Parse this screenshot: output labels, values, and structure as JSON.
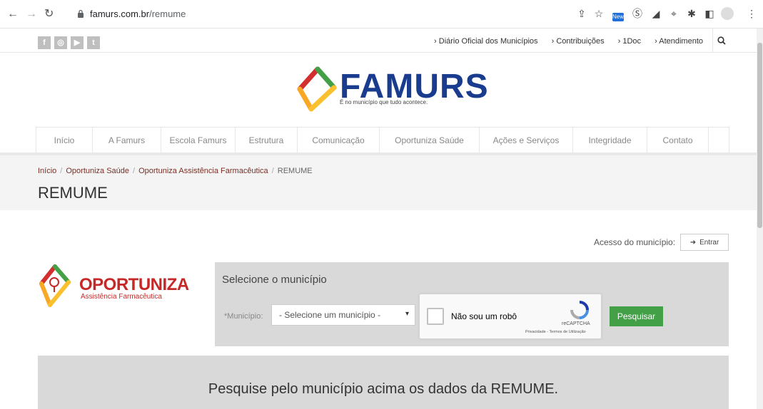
{
  "browser": {
    "url_domain": "famurs.com.br",
    "url_path": "/remume",
    "icons": [
      "back-icon",
      "forward-icon",
      "reload-icon",
      "lock-icon",
      "share-icon",
      "star-icon",
      "extension-icons",
      "menu-icon"
    ],
    "ext_badge": "New"
  },
  "topbar": {
    "social": [
      "f",
      "◎",
      "▶",
      "t"
    ],
    "links": [
      "› Diário Oficial dos Municípios",
      "› Contribuições",
      "› 1Doc",
      "› Atendimento"
    ],
    "search_icon": "search-icon"
  },
  "logo": {
    "name": "FAMURS",
    "tagline": "É no município que tudo acontece."
  },
  "nav": {
    "items": [
      {
        "label": "Início"
      },
      {
        "label": "A Famurs"
      },
      {
        "label": "Escola Famurs"
      },
      {
        "label": "Estrutura"
      },
      {
        "label": "Comunicação"
      },
      {
        "label": "Oportuniza Saúde"
      },
      {
        "label": "Ações e Serviços"
      },
      {
        "label": "Integridade"
      },
      {
        "label": "Contato"
      }
    ]
  },
  "breadcrumb": {
    "items": [
      "Início",
      "Oportuniza Saúde",
      "Oportuniza Assistência Farmacêutica"
    ],
    "current": "REMUME",
    "separator": "/"
  },
  "page_title": "REMUME",
  "access": {
    "label": "Acesso do município:",
    "button": "Entrar"
  },
  "oportuniza": {
    "title": "OPORTUNIZA",
    "subtitle": "Assistência Farmacêutica"
  },
  "select_panel": {
    "title": "Selecione o município",
    "label": "*Município:",
    "select_value": "- Selecione um município -",
    "captcha_text": "Não sou um robô",
    "captcha_brand": "reCAPTCHA",
    "captcha_links": "Privacidade - Termos de Utilização",
    "search_button": "Pesquisar"
  },
  "result": {
    "message": "Pesquise pelo município acima os dados da REMUME."
  },
  "colors": {
    "brand_blue": "#1a3c8f",
    "oportuniza_red": "#c62828",
    "button_green": "#43a047",
    "panel_gray": "#d9d9d9",
    "breadcrumb_link": "#7a2e24"
  }
}
